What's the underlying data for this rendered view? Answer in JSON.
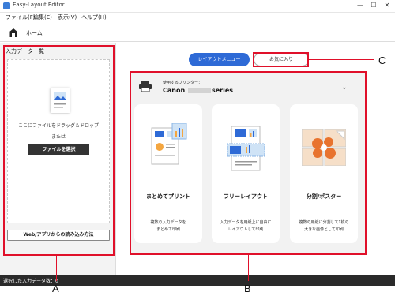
{
  "window": {
    "title": "Easy-Layout Editor",
    "controls": [
      "—",
      "☐",
      "✕"
    ]
  },
  "menu": [
    {
      "label": "ファイル(F)"
    },
    {
      "label": "編集(E)"
    },
    {
      "label": "表示(V)"
    },
    {
      "label": "ヘルプ(H)"
    }
  ],
  "home": {
    "label": "ホーム"
  },
  "input_panel": {
    "header": "入力データ一覧",
    "drop_text": "ここにファイルをドラッグ＆ドロップ",
    "or_text": "または",
    "select_button": "ファイルを選択",
    "web_button": "Web/アプリからの読み込み方法"
  },
  "status": {
    "text": "選択した入力データ数：0"
  },
  "tabs": {
    "layout_menu": "レイアウトメニュー",
    "favorites": "お気に入り"
  },
  "printer": {
    "label": "使用するプリンター：",
    "name_left": "Canon",
    "name_right": "series"
  },
  "cards": [
    {
      "title": "まとめてプリント",
      "desc1": "複数の入力データを",
      "desc2": "まとめて印刷"
    },
    {
      "title": "フリーレイアウト",
      "desc1": "入力データを用紙上に自由に",
      "desc2": "レイアウトして印刷"
    },
    {
      "title": "分割/ポスター",
      "desc1": "複数の用紙に分割して1枚の",
      "desc2": "大きな画像として印刷"
    }
  ],
  "callouts": {
    "a": "A",
    "b": "B",
    "c": "C"
  },
  "colors": {
    "accent": "#2e6ad6",
    "callout": "#e0102a",
    "status_bg": "#2a2a2a"
  }
}
